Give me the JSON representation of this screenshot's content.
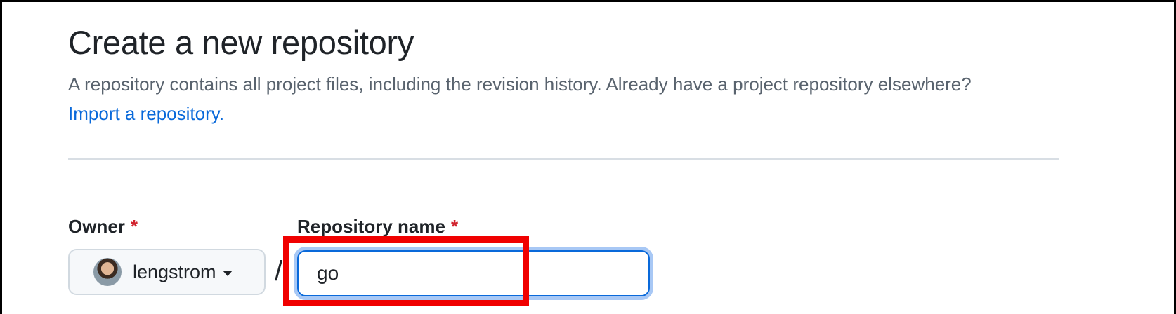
{
  "header": {
    "title": "Create a new repository",
    "description": "A repository contains all project files, including the revision history. Already have a project repository elsewhere?",
    "import_link": "Import a repository."
  },
  "form": {
    "owner_label": "Owner",
    "required_mark": "*",
    "owner_value": "lengstrom",
    "separator": "/",
    "repo_label": "Repository name",
    "repo_value": "go"
  },
  "colors": {
    "accent": "#0969da",
    "required": "#d1242f",
    "highlight": "#f00000"
  }
}
